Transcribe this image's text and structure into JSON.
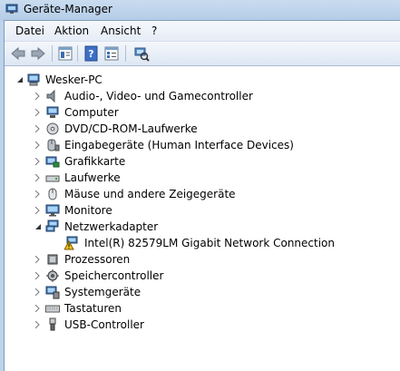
{
  "window": {
    "title": "Geräte-Manager"
  },
  "menu": [
    "Datei",
    "Aktion",
    "Ansicht",
    "?"
  ],
  "tree": {
    "root": "Wesker-PC",
    "categories": [
      "Audio-, Video- und Gamecontroller",
      "Computer",
      "DVD/CD-ROM-Laufwerke",
      "Eingabegeräte (Human Interface Devices)",
      "Grafikkarte",
      "Laufwerke",
      "Mäuse und andere Zeigegeräte",
      "Monitore",
      "Netzwerkadapter",
      "Prozessoren",
      "Speichercontroller",
      "Systemgeräte",
      "Tastaturen",
      "USB-Controller"
    ],
    "network_child": "Intel(R) 82579LM Gigabit Network Connection"
  }
}
